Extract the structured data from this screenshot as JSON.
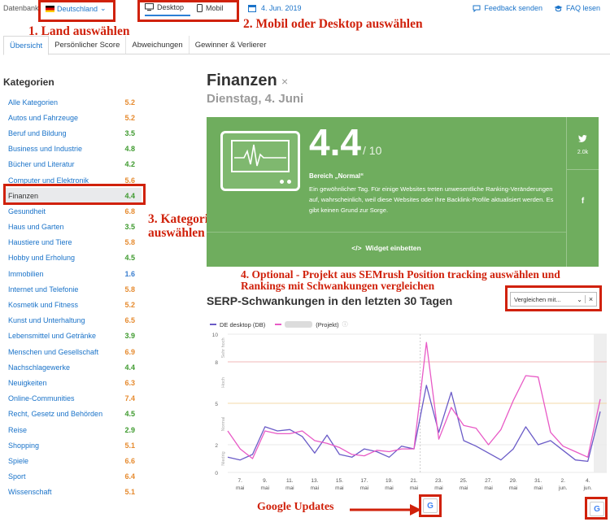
{
  "topbar": {
    "db_label": "Datenbank",
    "country": "Deutschland",
    "device_desktop": "Desktop",
    "device_mobile": "Mobil",
    "date": "4. Jun. 2019",
    "feedback": "Feedback senden",
    "faq": "FAQ lesen"
  },
  "tabs": [
    "Übersicht",
    "Persönlicher Score",
    "Abweichungen",
    "Gewinner & Verlierer"
  ],
  "sidebar": {
    "title": "Kategorien",
    "items": [
      {
        "label": "Alle Kategorien",
        "value": "5.2",
        "color": "orange"
      },
      {
        "label": "Autos und Fahrzeuge",
        "value": "5.2",
        "color": "orange"
      },
      {
        "label": "Beruf und Bildung",
        "value": "3.5",
        "color": "green"
      },
      {
        "label": "Business und Industrie",
        "value": "4.8",
        "color": "green"
      },
      {
        "label": "Bücher und Literatur",
        "value": "4.2",
        "color": "green"
      },
      {
        "label": "Computer und Elektronik",
        "value": "5.6",
        "color": "orange"
      },
      {
        "label": "Finanzen",
        "value": "4.4",
        "color": "green",
        "selected": true
      },
      {
        "label": "Gesundheit",
        "value": "6.8",
        "color": "orange"
      },
      {
        "label": "Haus und Garten",
        "value": "3.5",
        "color": "green"
      },
      {
        "label": "Haustiere und Tiere",
        "value": "5.8",
        "color": "orange"
      },
      {
        "label": "Hobby und Erholung",
        "value": "4.5",
        "color": "green"
      },
      {
        "label": "Immobilien",
        "value": "1.6",
        "color": "blue"
      },
      {
        "label": "Internet und Telefonie",
        "value": "5.8",
        "color": "orange"
      },
      {
        "label": "Kosmetik und Fitness",
        "value": "5.2",
        "color": "orange"
      },
      {
        "label": "Kunst und Unterhaltung",
        "value": "6.5",
        "color": "orange"
      },
      {
        "label": "Lebensmittel und Getränke",
        "value": "3.9",
        "color": "green"
      },
      {
        "label": "Menschen und Gesellschaft",
        "value": "6.9",
        "color": "orange"
      },
      {
        "label": "Nachschlagewerke",
        "value": "4.4",
        "color": "green"
      },
      {
        "label": "Neuigkeiten",
        "value": "6.3",
        "color": "orange"
      },
      {
        "label": "Online-Communities",
        "value": "7.4",
        "color": "orange"
      },
      {
        "label": "Recht, Gesetz und Behörden",
        "value": "4.5",
        "color": "green"
      },
      {
        "label": "Reise",
        "value": "2.9",
        "color": "green"
      },
      {
        "label": "Shopping",
        "value": "5.1",
        "color": "orange"
      },
      {
        "label": "Spiele",
        "value": "6.6",
        "color": "orange"
      },
      {
        "label": "Sport",
        "value": "6.4",
        "color": "orange"
      },
      {
        "label": "Wissenschaft",
        "value": "5.1",
        "color": "orange"
      }
    ]
  },
  "main": {
    "title": "Finanzen",
    "close": "×",
    "date": "Dienstag, 4. Juni",
    "score": "4.4",
    "score_of": "/ 10",
    "range": "Bereich „Normal“",
    "description": "Ein gewöhnlicher Tag. Für einige Websites treten unwesentliche Ranking-Veränderungen auf, wahrscheinlich, weil diese Websites oder ihre Backlink-Profile aktualisiert werden. Es gibt keinen Grund zur Sorge.",
    "widget": "Widget einbetten",
    "twitter_count": "2.0k",
    "serp_title": "SERP-Schwankungen in den letzten 30 Tagen",
    "compare_placeholder": "Vergleichen mit...",
    "legend_desktop": "DE desktop (DB)",
    "legend_project": "(Projekt)"
  },
  "annotations": {
    "a1": "1. Land auswählen",
    "a2": "2. Mobil oder Desktop auswählen",
    "a3_line1": "3. Kategorie",
    "a3_line2": "auswählen",
    "a4_line1": "4. Optional - Projekt aus SEMrush Position tracking auswählen und",
    "a4_line2": "Rankings mit Schwankungen vergleichen",
    "google": "Google Updates"
  },
  "colors": {
    "green": "#3e9a2e",
    "orange": "#e68a2e",
    "blue": "#3b7fd0",
    "panel": "#6fad5e",
    "series_db": "#6a5bc7",
    "series_project": "#e85ac6",
    "annotation": "#d0210b"
  },
  "chart_data": {
    "type": "line",
    "ylim": [
      0,
      10
    ],
    "yticks": [
      0,
      2,
      5,
      8,
      10
    ],
    "zones": [
      "Niedrig",
      "Normal",
      "Hoch",
      "Sehr hoch"
    ],
    "x_tick_labels": [
      [
        "7.",
        "mai"
      ],
      [
        "9.",
        "mai"
      ],
      [
        "11.",
        "mai"
      ],
      [
        "13.",
        "mai"
      ],
      [
        "15.",
        "mai"
      ],
      [
        "17.",
        "mai"
      ],
      [
        "19.",
        "mai"
      ],
      [
        "21.",
        "mai"
      ],
      [
        "23.",
        "mai"
      ],
      [
        "25.",
        "mai"
      ],
      [
        "27.",
        "mai"
      ],
      [
        "29.",
        "mai"
      ],
      [
        "31.",
        "mai"
      ],
      [
        "2.",
        "jun."
      ],
      [
        "4.",
        "jun."
      ]
    ],
    "series": [
      {
        "name": "DE desktop (DB)",
        "color": "#6a5bc7",
        "values": [
          1.1,
          0.9,
          1.3,
          3.3,
          3.0,
          3.1,
          2.6,
          1.4,
          2.7,
          1.3,
          1.1,
          1.7,
          1.5,
          1.1,
          1.9,
          1.7,
          6.3,
          2.9,
          5.8,
          2.3,
          1.9,
          1.4,
          0.9,
          1.7,
          3.3,
          2.0,
          2.3,
          1.6,
          0.9,
          0.8,
          4.4
        ]
      },
      {
        "name": "(Projekt)",
        "color": "#e85ac6",
        "values": [
          3.0,
          1.7,
          1.0,
          3.0,
          2.8,
          2.8,
          3.0,
          2.3,
          2.1,
          1.8,
          1.3,
          1.2,
          1.6,
          1.5,
          1.7,
          1.7,
          9.4,
          2.4,
          4.7,
          3.4,
          3.2,
          2.0,
          3.1,
          5.2,
          7.0,
          6.9,
          2.9,
          1.9,
          1.5,
          1.1,
          5.3
        ]
      }
    ]
  }
}
